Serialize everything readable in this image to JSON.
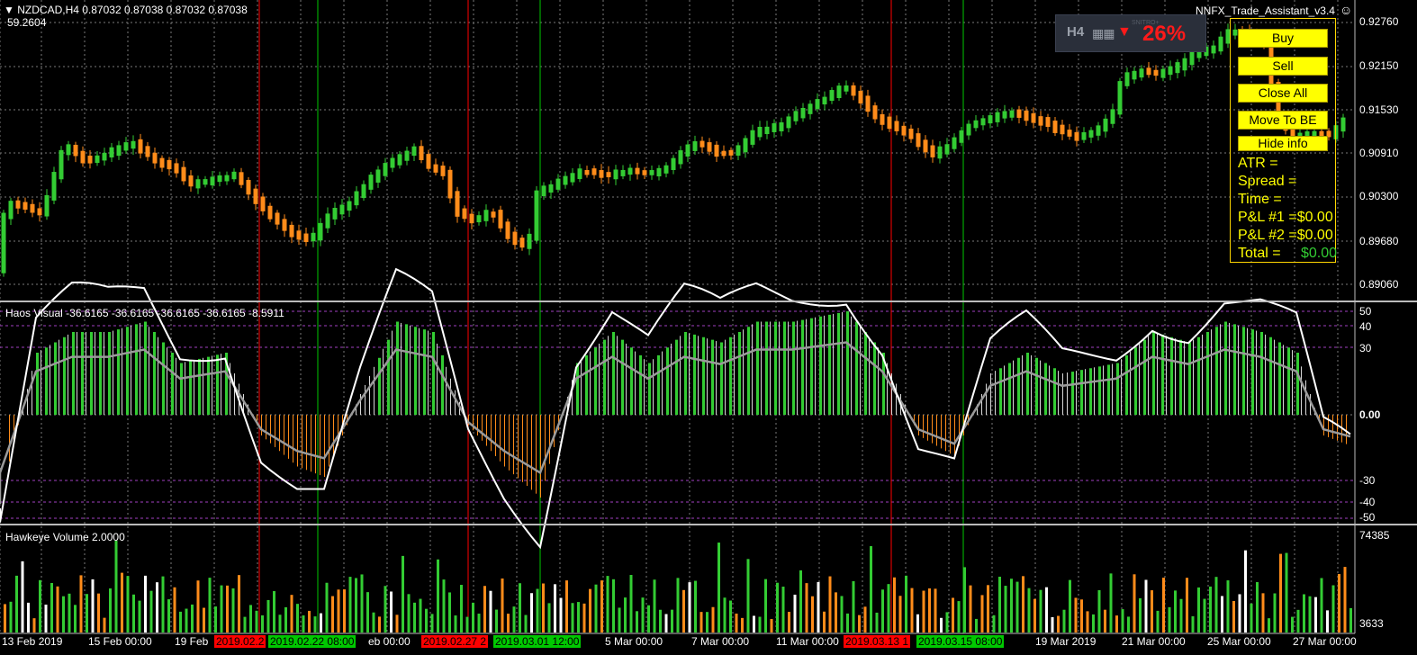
{
  "header": {
    "symbol_line": "NZDCAD,H4  0.87032 0.87038 0.87032 0.87038",
    "sub_value": "59.2604",
    "ea_name": "NNFX_Trade_Assistant_v3.4"
  },
  "badge": {
    "timeframe": "H4",
    "brand": "SNITRO+",
    "percent": "26%"
  },
  "price_axis": [
    "0.92760",
    "0.92150",
    "0.91530",
    "0.90910",
    "0.90300",
    "0.89680",
    "0.89060"
  ],
  "haos": {
    "label": "Haos Visual -36.6165 -36.6165 -36.6165 -36.6165 -8.5911",
    "axis": [
      "50",
      "40",
      "30",
      "0.00",
      "-30",
      "-40",
      "-50"
    ]
  },
  "volume": {
    "label": "Hawkeye Volume 2.0000",
    "axis_max": "74385",
    "axis_min": "3633"
  },
  "time_axis": [
    "13 Feb 2019",
    "15 Feb 00:00",
    "19 Feb",
    "eb 00:00",
    "5 Mar 00:00",
    "7 Mar 00:00",
    "11 Mar 00:00",
    "19 Mar 2019",
    "21 Mar 00:00",
    "25 Mar 00:00",
    "27 Mar 00:00"
  ],
  "date_tags": [
    {
      "text": "2019.02.2",
      "color": "#ff0000"
    },
    {
      "text": "2019.02.22 08:00",
      "color": "#00c800"
    },
    {
      "text": "2019.02.27 2",
      "color": "#ff0000"
    },
    {
      "text": "2019.03.01 12:00",
      "color": "#00c800"
    },
    {
      "text": "2019.03.13 1",
      "color": "#ff0000"
    },
    {
      "text": "2019.03.15 08:00",
      "color": "#00c800"
    }
  ],
  "trade_panel": {
    "buy": "Buy",
    "sell": "Sell",
    "close_all": "Close All",
    "move_to_be": "Move To BE",
    "hide_info": "Hide info",
    "atr": "ATR =",
    "spread": "Spread =",
    "time": "Time =",
    "pl1": "P&L #1 =",
    "pl1_val": "$0.00",
    "pl2": "P&L #2 =",
    "pl2_val": "$0.00",
    "total": "Total =",
    "total_val": "$0.00"
  },
  "colors": {
    "bull": "#33cc33",
    "bear": "#ff8c1a",
    "sell_line": "#ff0000",
    "buy_line": "#00c800",
    "grid": "#7a7a7a"
  }
}
